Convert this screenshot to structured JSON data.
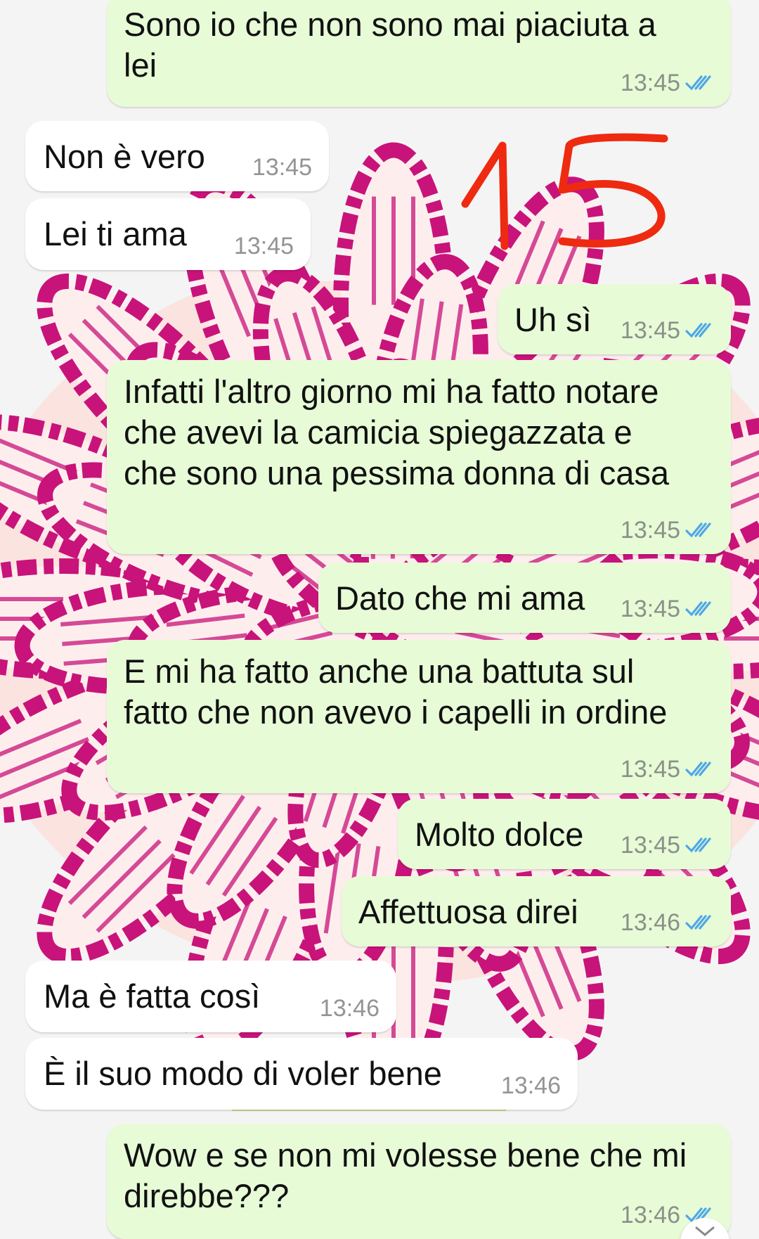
{
  "annotation": {
    "number": "15",
    "color": "#ee2a10"
  },
  "colors": {
    "outgoing_bubble": "#e7fbd7",
    "incoming_bubble": "#ffffff",
    "read_ticks": "#4fa7e8",
    "flower_magenta": "#c8137a"
  },
  "messages": [
    {
      "dir": "out",
      "text": "Sono io che non sono mai piaciuta a\nlei",
      "time": "13:45",
      "read": true
    },
    {
      "dir": "in",
      "text": "Non è vero",
      "time": "13:45"
    },
    {
      "dir": "in",
      "text": "Lei ti ama",
      "time": "13:45"
    },
    {
      "dir": "out",
      "text": "Uh sì",
      "time": "13:45",
      "read": true
    },
    {
      "dir": "out",
      "text": "Infatti l'altro giorno mi ha fatto notare\nche avevi la camicia spiegazzata e\nche sono una pessima donna di casa",
      "time": "13:45",
      "read": true
    },
    {
      "dir": "out",
      "text": "Dato che mi ama",
      "time": "13:45",
      "read": true
    },
    {
      "dir": "out",
      "text": "E mi ha fatto anche una battuta sul\nfatto che non avevo i capelli in ordine",
      "time": "13:45",
      "read": true
    },
    {
      "dir": "out",
      "text": "Molto dolce",
      "time": "13:45",
      "read": true
    },
    {
      "dir": "out",
      "text": "Affettuosa direi",
      "time": "13:46",
      "read": true
    },
    {
      "dir": "in",
      "text": "Ma è fatta così",
      "time": "13:46"
    },
    {
      "dir": "in",
      "text": "È il suo modo di voler bene",
      "time": "13:46"
    },
    {
      "dir": "out",
      "text": "Wow e se non mi volesse bene che mi\ndirebbe???",
      "time": "13:46",
      "read": true
    }
  ],
  "scroll_button_icon": "chevron-down-icon"
}
